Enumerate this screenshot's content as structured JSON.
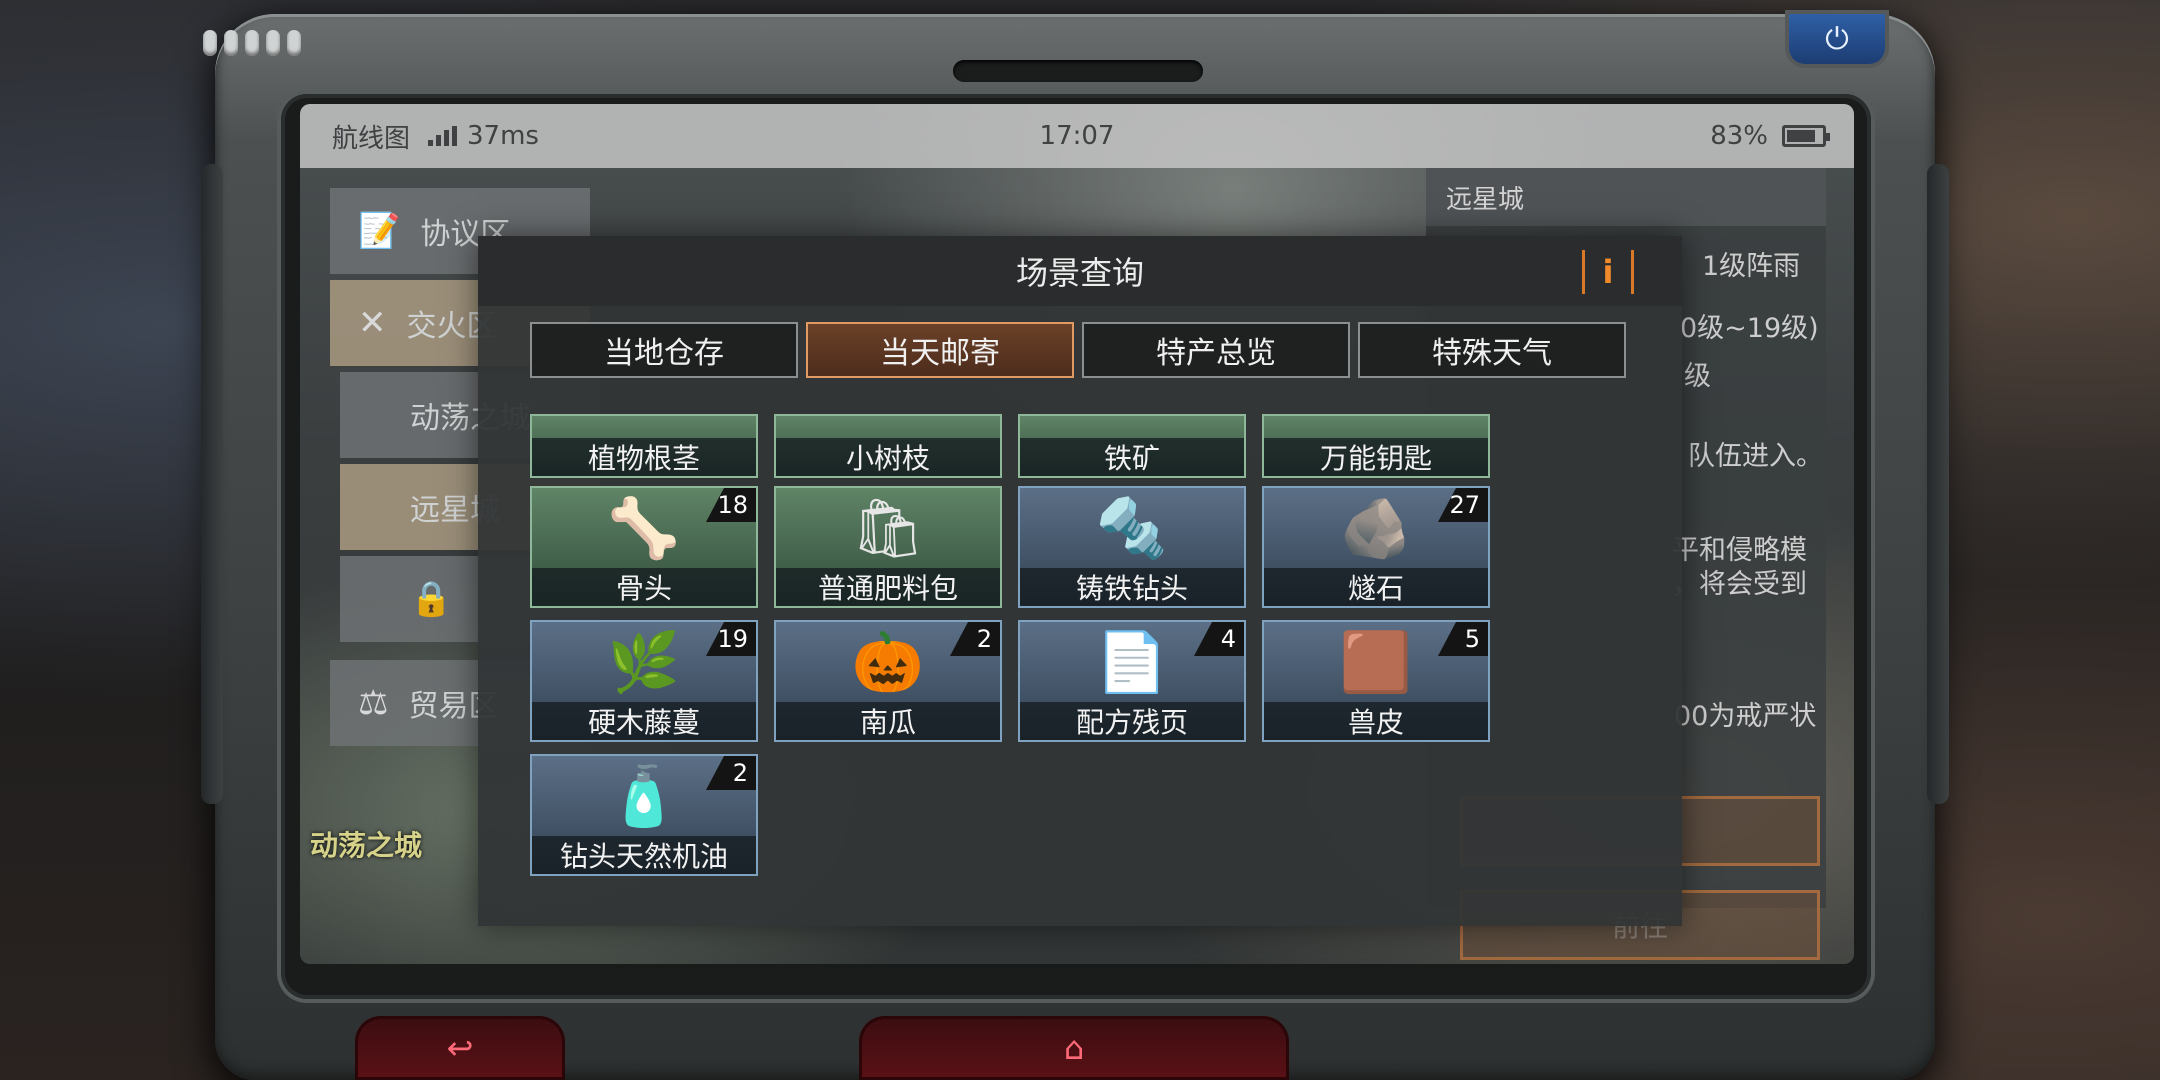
{
  "status_bar": {
    "app_name": "航线图",
    "ping": "37ms",
    "time": "17:07",
    "battery": "83%",
    "battery_level": 0.83
  },
  "sidebar": {
    "items": [
      {
        "label": "协议区",
        "icon": "document-icon"
      },
      {
        "label": "交火区",
        "icon": "crossed-rifles-icon"
      },
      {
        "label": "动荡之城"
      },
      {
        "label": "远星城"
      },
      {
        "label": "",
        "icon": "lock-icon"
      },
      {
        "label": "贸易区",
        "icon": "gavel-icon"
      }
    ],
    "map_label": "动荡之城"
  },
  "right_panel": {
    "title": "远星城",
    "weather": "1级阵雨",
    "level_range": "0级~19级)",
    "line3": "级",
    "line4": "队伍进入。",
    "line5": "平和侵略模",
    "line6": "，将会受到",
    "line7": "00为戒严状",
    "button2_label": "前往"
  },
  "modal": {
    "title": "场景查询",
    "info_label": "i",
    "tabs": [
      {
        "label": "当地仓存",
        "active": false
      },
      {
        "label": "当天邮寄",
        "active": true
      },
      {
        "label": "特产总览",
        "active": false
      },
      {
        "label": "特殊天气",
        "active": false
      }
    ]
  },
  "items": [
    {
      "name": "植物根茎",
      "count": "",
      "theme": "green",
      "icon": "roots-icon"
    },
    {
      "name": "小树枝",
      "count": "",
      "theme": "green",
      "icon": "twig-icon"
    },
    {
      "name": "铁矿",
      "count": "",
      "theme": "green",
      "icon": "iron-ore-icon"
    },
    {
      "name": "万能钥匙",
      "count": "",
      "theme": "green",
      "icon": "key-icon"
    },
    {
      "name": "骨头",
      "count": "18",
      "theme": "green",
      "icon": "bone-icon"
    },
    {
      "name": "普通肥料包",
      "count": "",
      "theme": "green",
      "icon": "fertilizer-bag-icon"
    },
    {
      "name": "铸铁钻头",
      "count": "",
      "theme": "blue",
      "icon": "drill-bit-icon"
    },
    {
      "name": "燧石",
      "count": "27",
      "theme": "blue",
      "icon": "flint-icon"
    },
    {
      "name": "硬木藤蔓",
      "count": "19",
      "theme": "blue",
      "icon": "vine-icon"
    },
    {
      "name": "南瓜",
      "count": "2",
      "theme": "blue",
      "icon": "pumpkin-icon"
    },
    {
      "name": "配方残页",
      "count": "4",
      "theme": "blue",
      "icon": "recipe-page-icon"
    },
    {
      "name": "兽皮",
      "count": "5",
      "theme": "blue",
      "icon": "hide-icon"
    },
    {
      "name": "钻头天然机油",
      "count": "2",
      "theme": "blue",
      "icon": "oil-jug-icon"
    }
  ],
  "controls": {
    "back_icon": "back-icon",
    "home_icon": "home-icon",
    "power_icon": "power-icon"
  },
  "colors": {
    "accent_orange": "#e19a63",
    "info_orange": "#f08a2a",
    "green_tile": "#4f7258",
    "blue_tile": "#4a5c72"
  }
}
